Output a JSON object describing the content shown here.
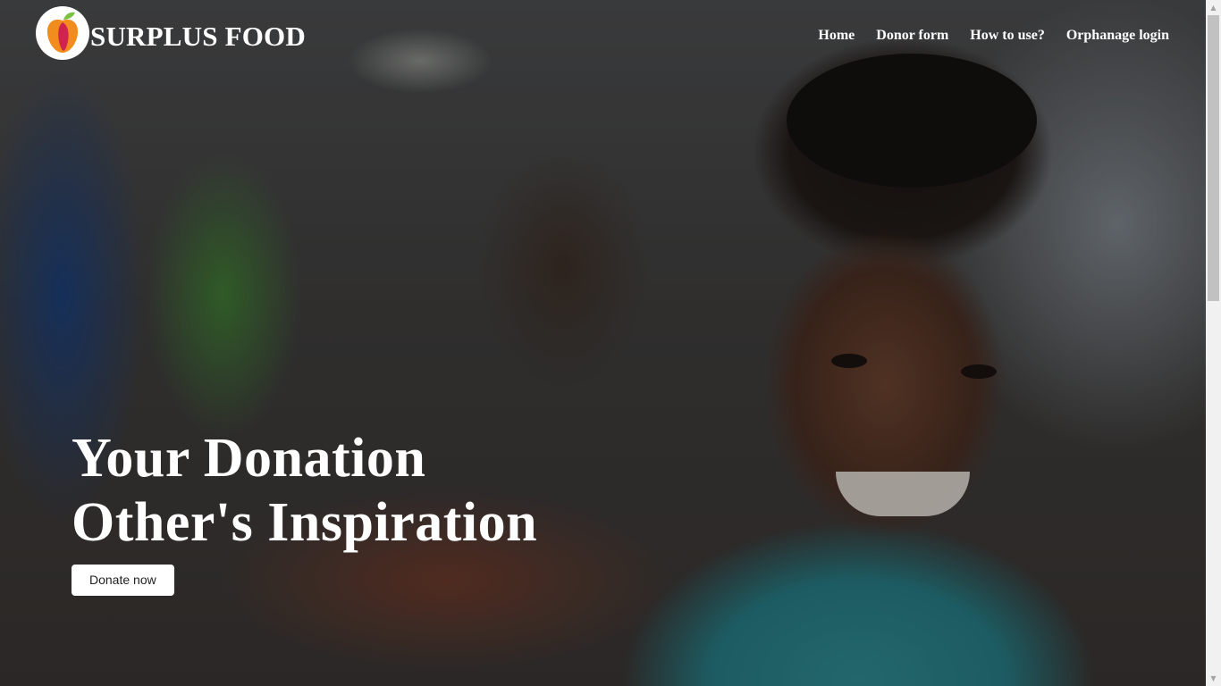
{
  "brand": {
    "name": "SURPLUS FOOD",
    "logo_icon": "apple-logo-icon",
    "logo_colors": [
      "#f28c1e",
      "#d0244f",
      "#7cc242"
    ]
  },
  "nav": {
    "links": [
      {
        "label": "Home"
      },
      {
        "label": "Donor form"
      },
      {
        "label": "How to use?"
      },
      {
        "label": "Orphanage login"
      }
    ]
  },
  "hero": {
    "title_line1": "Your Donation",
    "title_line2": "Other's Inspiration",
    "cta_label": "Donate now"
  },
  "colors": {
    "text": "#ffffff",
    "button_bg": "#ffffff",
    "button_text": "#222222"
  }
}
